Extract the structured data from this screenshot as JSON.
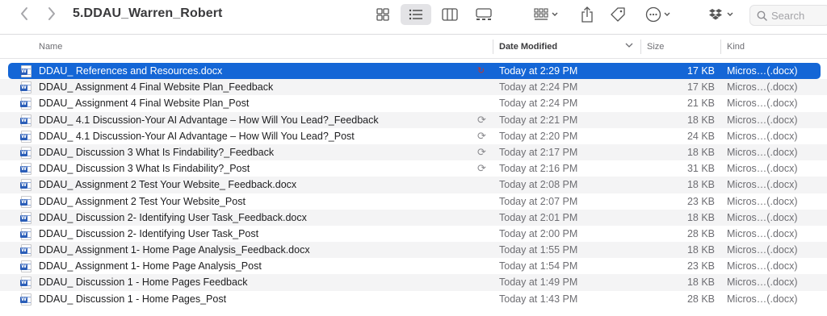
{
  "window": {
    "title": "5.DDAU_Warren_Robert"
  },
  "toolbar": {
    "back_icon": "chevron-left-icon",
    "forward_icon": "chevron-right-icon",
    "view_modes": [
      "icon-view",
      "list-view",
      "column-view",
      "gallery-view"
    ],
    "active_view": "list-view",
    "search_placeholder": "Search"
  },
  "columns": {
    "name": "Name",
    "date": "Date Modified",
    "size": "Size",
    "kind": "Kind"
  },
  "colors": {
    "selection": "#1466d6",
    "alt_row": "#f4f4f5",
    "word_blue": "#2b5eb8"
  },
  "files": [
    {
      "name": "DDAU_ References and Resources.docx",
      "date": "Today at 2:29 PM",
      "size": "17 KB",
      "kind": "Micros…(.docx)",
      "sync": "↻",
      "selected": true
    },
    {
      "name": "DDAU_  Assignment 4 Final Website Plan_Feedback",
      "date": "Today at 2:24 PM",
      "size": "17 KB",
      "kind": "Micros…(.docx)",
      "sync": ""
    },
    {
      "name": "DDAU_  Assignment 4 Final Website Plan_Post",
      "date": "Today at 2:24 PM",
      "size": "21 KB",
      "kind": "Micros…(.docx)",
      "sync": ""
    },
    {
      "name": "DDAU_  4.1 Discussion-Your AI Advantage – How Will You Lead?_Feedback",
      "date": "Today at 2:21 PM",
      "size": "18 KB",
      "kind": "Micros…(.docx)",
      "sync": "⟳"
    },
    {
      "name": "DDAU_  4.1 Discussion-Your AI Advantage – How Will You Lead?_Post",
      "date": "Today at 2:20 PM",
      "size": "24 KB",
      "kind": "Micros…(.docx)",
      "sync": "⟳"
    },
    {
      "name": "DDAU_  Discussion 3 What Is Findability?_Feedback",
      "date": "Today at 2:17 PM",
      "size": "18 KB",
      "kind": "Micros…(.docx)",
      "sync": "⟳"
    },
    {
      "name": "DDAU_  Discussion 3 What Is Findability?_Post",
      "date": "Today at 2:16 PM",
      "size": "31 KB",
      "kind": "Micros…(.docx)",
      "sync": "⟳"
    },
    {
      "name": "DDAU_ Assignment 2 Test Your Website_ Feedback.docx",
      "date": "Today at 2:08 PM",
      "size": "18 KB",
      "kind": "Micros…(.docx)",
      "sync": ""
    },
    {
      "name": "DDAU_  Assignment 2 Test Your Website_Post",
      "date": "Today at 2:07 PM",
      "size": "23 KB",
      "kind": "Micros…(.docx)",
      "sync": ""
    },
    {
      "name": "DDAU_  Discussion 2- Identifying User Task_Feedback.docx",
      "date": "Today at 2:01 PM",
      "size": "18 KB",
      "kind": "Micros…(.docx)",
      "sync": ""
    },
    {
      "name": "DDAU_  Discussion 2- Identifying User Task_Post",
      "date": "Today at 2:00 PM",
      "size": "28 KB",
      "kind": "Micros…(.docx)",
      "sync": ""
    },
    {
      "name": "DDAU_  Assignment 1- Home Page Analysis_Feedback.docx",
      "date": "Today at 1:55 PM",
      "size": "18 KB",
      "kind": "Micros…(.docx)",
      "sync": ""
    },
    {
      "name": "DDAU_  Assignment 1- Home Page Analysis_Post",
      "date": "Today at 1:54 PM",
      "size": "23 KB",
      "kind": "Micros…(.docx)",
      "sync": ""
    },
    {
      "name": "DDAU_ Discussion 1 - Home Pages Feedback",
      "date": "Today at 1:49 PM",
      "size": "18 KB",
      "kind": "Micros…(.docx)",
      "sync": ""
    },
    {
      "name": "DDAU_  Discussion 1 - Home Pages_Post",
      "date": "Today at 1:43 PM",
      "size": "28 KB",
      "kind": "Micros…(.docx)",
      "sync": ""
    }
  ]
}
